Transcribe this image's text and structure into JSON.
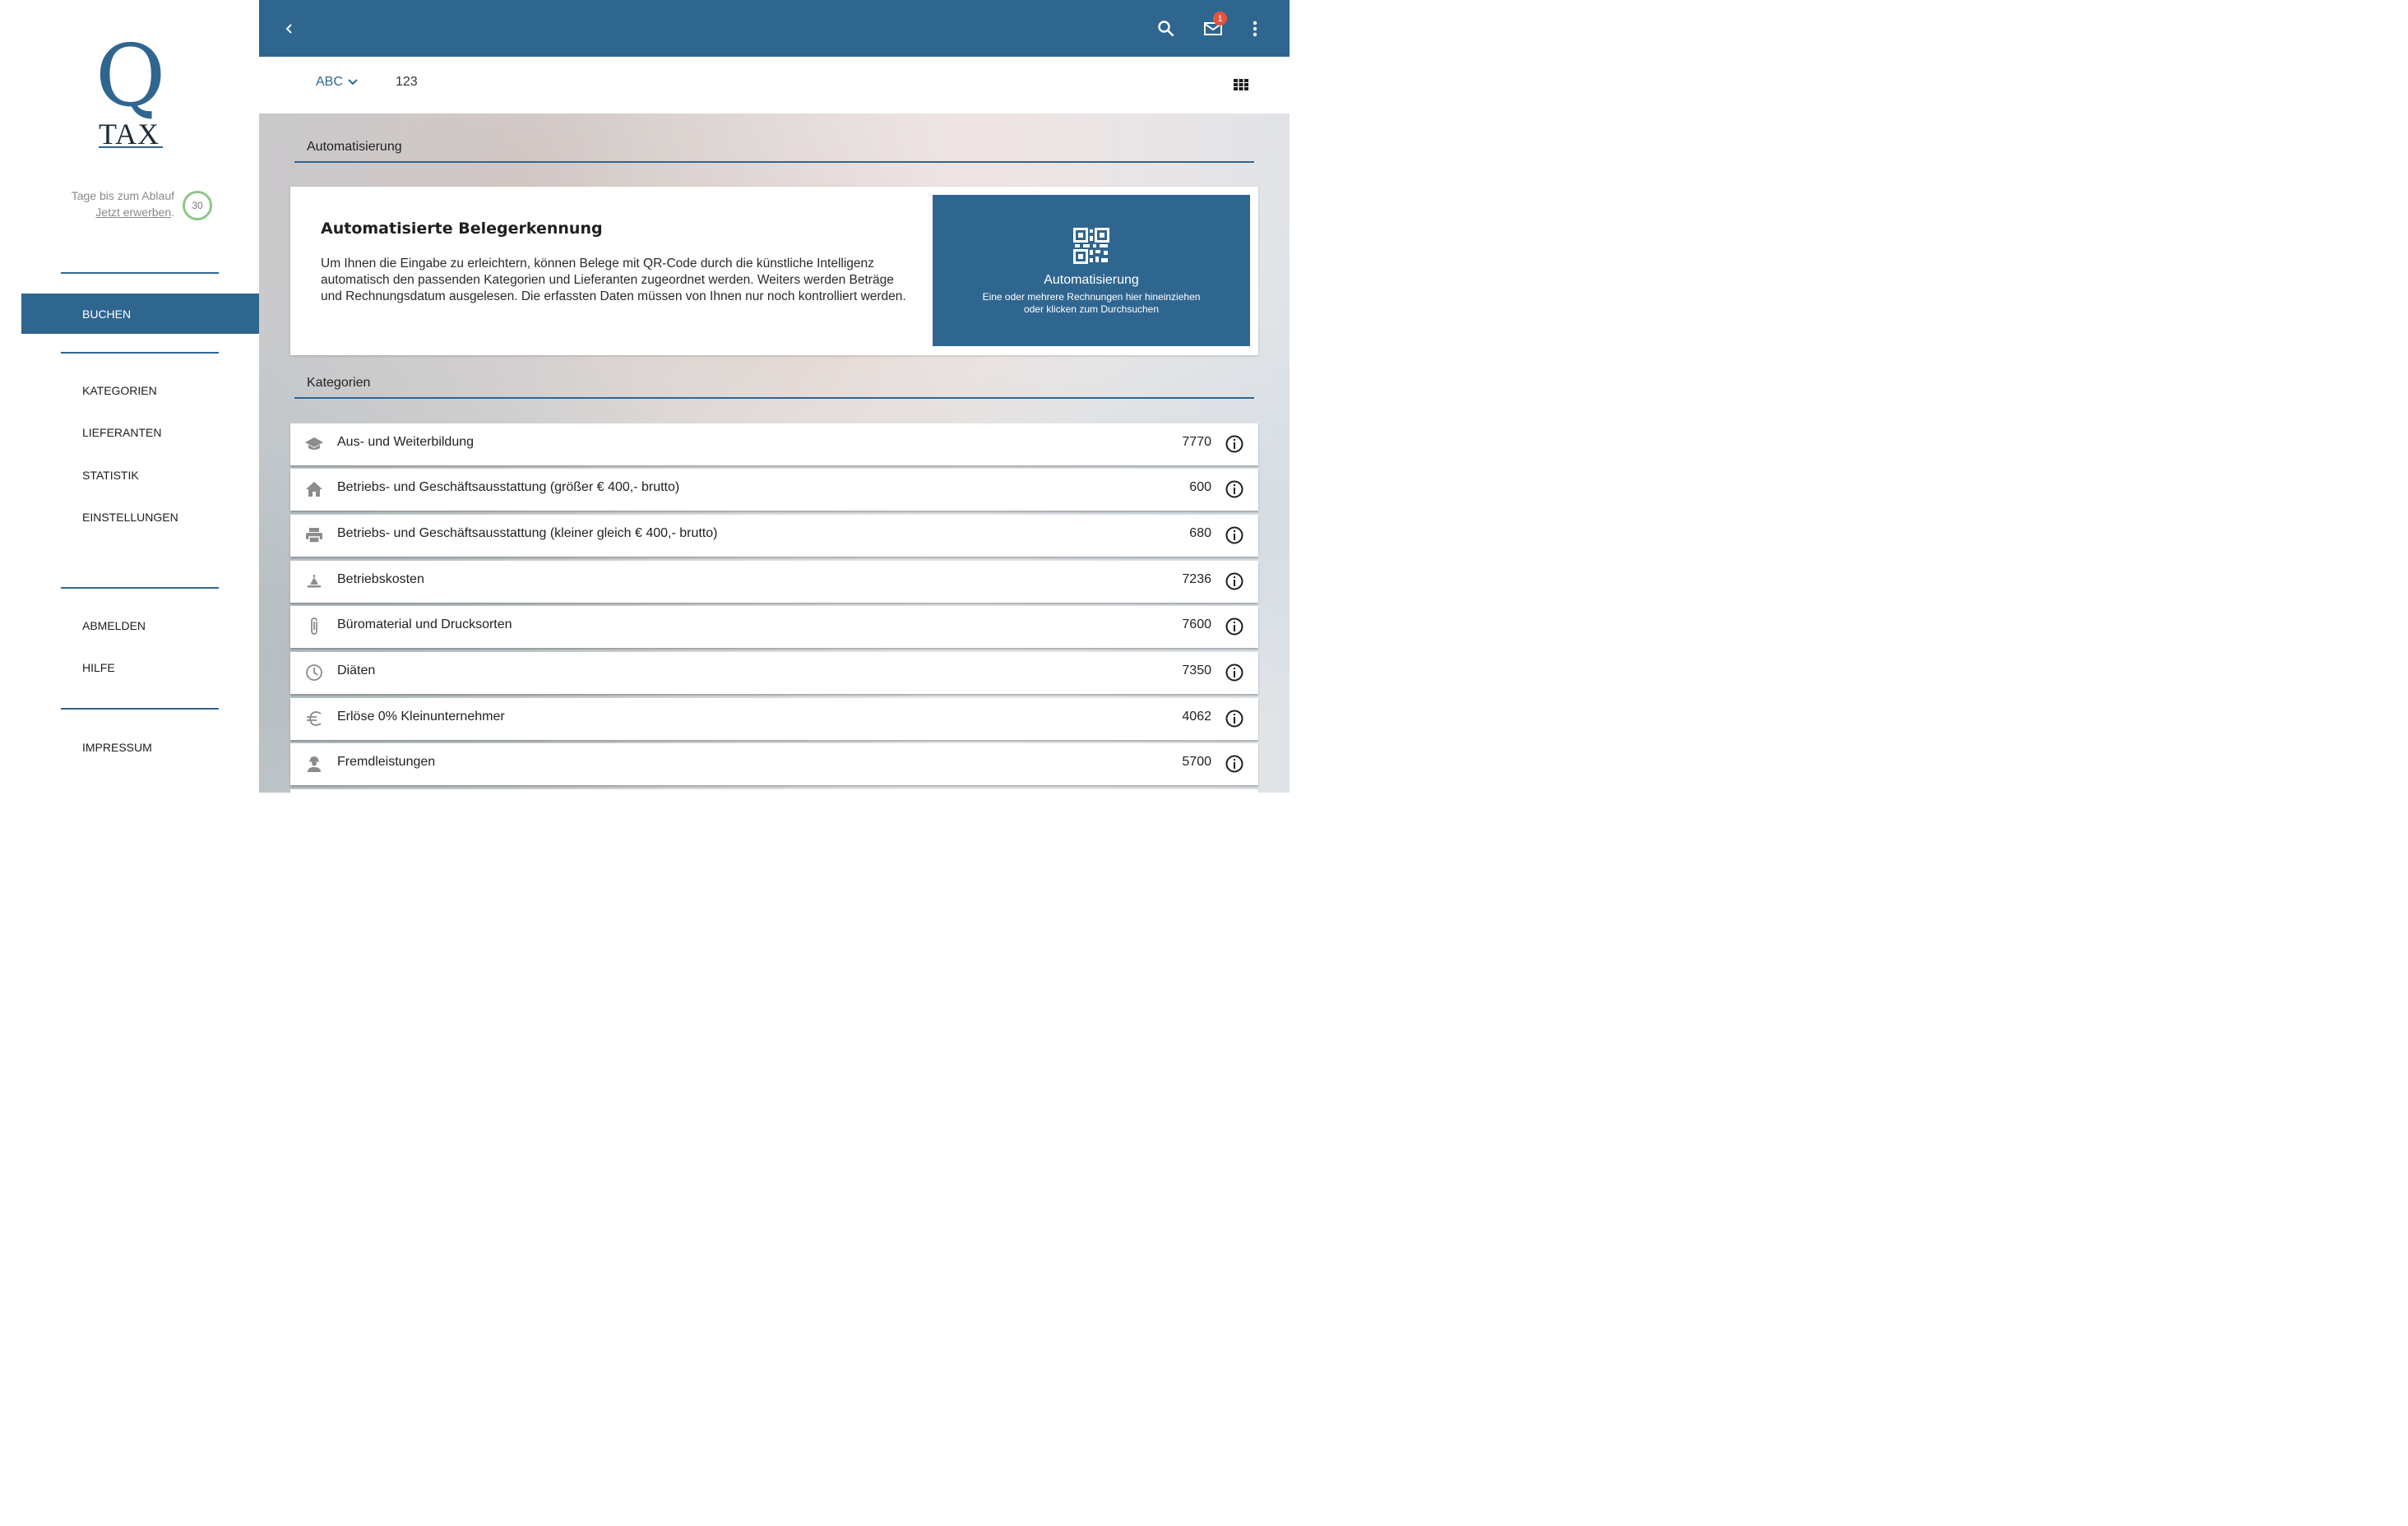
{
  "brand": {
    "logo_q": "Q",
    "logo_tax": "TAX",
    "accent": "#2f6690"
  },
  "trial": {
    "text": "Tage bis zum Ablauf",
    "link": "Jetzt erwerben",
    "link_suffix": ".",
    "days": "30"
  },
  "nav": {
    "primary": "BUCHEN",
    "secondary": [
      "KATEGORIEN",
      "LIEFERANTEN",
      "STATISTIK",
      "EINSTELLUNGEN"
    ],
    "tertiary": [
      "ABMELDEN",
      "HILFE"
    ],
    "footer": "IMPRESSUM"
  },
  "topbar": {
    "mail_badge": "1",
    "icons": [
      "back-icon",
      "search-icon",
      "mail-icon",
      "more-vert-icon"
    ]
  },
  "subbar": {
    "company_select": "ABC",
    "number": "123"
  },
  "automation": {
    "section_title": "Automatisierung",
    "heading": "Automatisierte Belegerkennung",
    "text": "Um Ihnen die Eingabe zu erleichtern, können Belege mit QR-Code durch die künstliche Intelligenz automatisch den passenden Kategorien und Lieferanten zugeordnet werden. Weiters werden Beträge und Rechnungsdatum ausgelesen. Die erfassten Daten müssen von Ihnen nur noch kontrolliert werden.",
    "drop_title": "Automatisierung",
    "drop_line1": "Eine oder mehrere Rechnungen hier hineinziehen",
    "drop_line2": "oder klicken zum Durchsuchen"
  },
  "categories": {
    "section_title": "Kategorien",
    "items": [
      {
        "icon": "school-icon",
        "label": "Aus- und Weiterbildung",
        "number": "7770"
      },
      {
        "icon": "home-icon",
        "label": "Betriebs- und Geschäftsausstattung (größer € 400,- brutto)",
        "number": "600"
      },
      {
        "icon": "printer-icon",
        "label": "Betriebs- und Geschäftsausstattung (kleiner gleich € 400,- brutto)",
        "number": "680"
      },
      {
        "icon": "bell-icon",
        "label": "Betriebskosten",
        "number": "7236"
      },
      {
        "icon": "paperclip-icon",
        "label": "Büromaterial und Drucksorten",
        "number": "7600"
      },
      {
        "icon": "clock-icon",
        "label": "Diäten",
        "number": "7350"
      },
      {
        "icon": "euro-icon",
        "label": "Erlöse 0% Kleinunternehmer",
        "number": "4062"
      },
      {
        "icon": "worker-icon",
        "label": "Fremdleistungen",
        "number": "5700"
      }
    ]
  }
}
